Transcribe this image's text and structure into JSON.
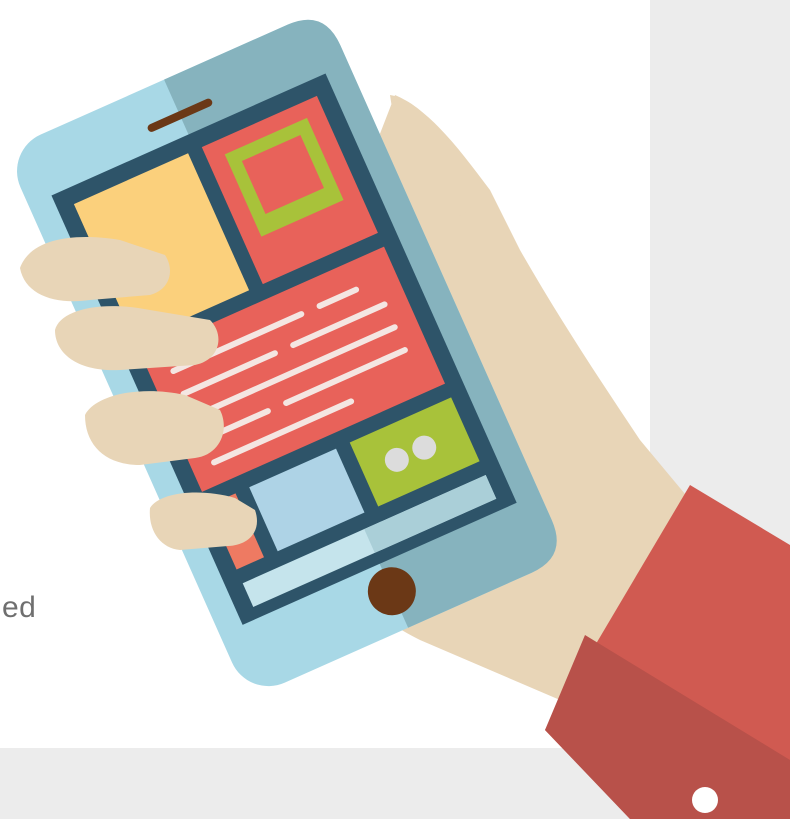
{
  "page": {
    "partial_text": "ed"
  },
  "colors": {
    "background": "#ffffff",
    "panel": "#ececec",
    "skin": "#e8d5b7",
    "phone_body_light": "#a8d8e6",
    "phone_body_dark": "#86b3be",
    "screen_frame": "#2e5469",
    "sleeve": "#d05a51",
    "sleeve_dark": "#b8514a",
    "tile_yellow": "#fbd07c",
    "tile_red": "#e8625a",
    "tile_green": "#a8c23a",
    "tile_blue": "#aed3e6",
    "tile_orange": "#ee7a62",
    "home_button": "#6b3816"
  },
  "icons": {
    "illustration": "hand-holding-phone-icon"
  }
}
